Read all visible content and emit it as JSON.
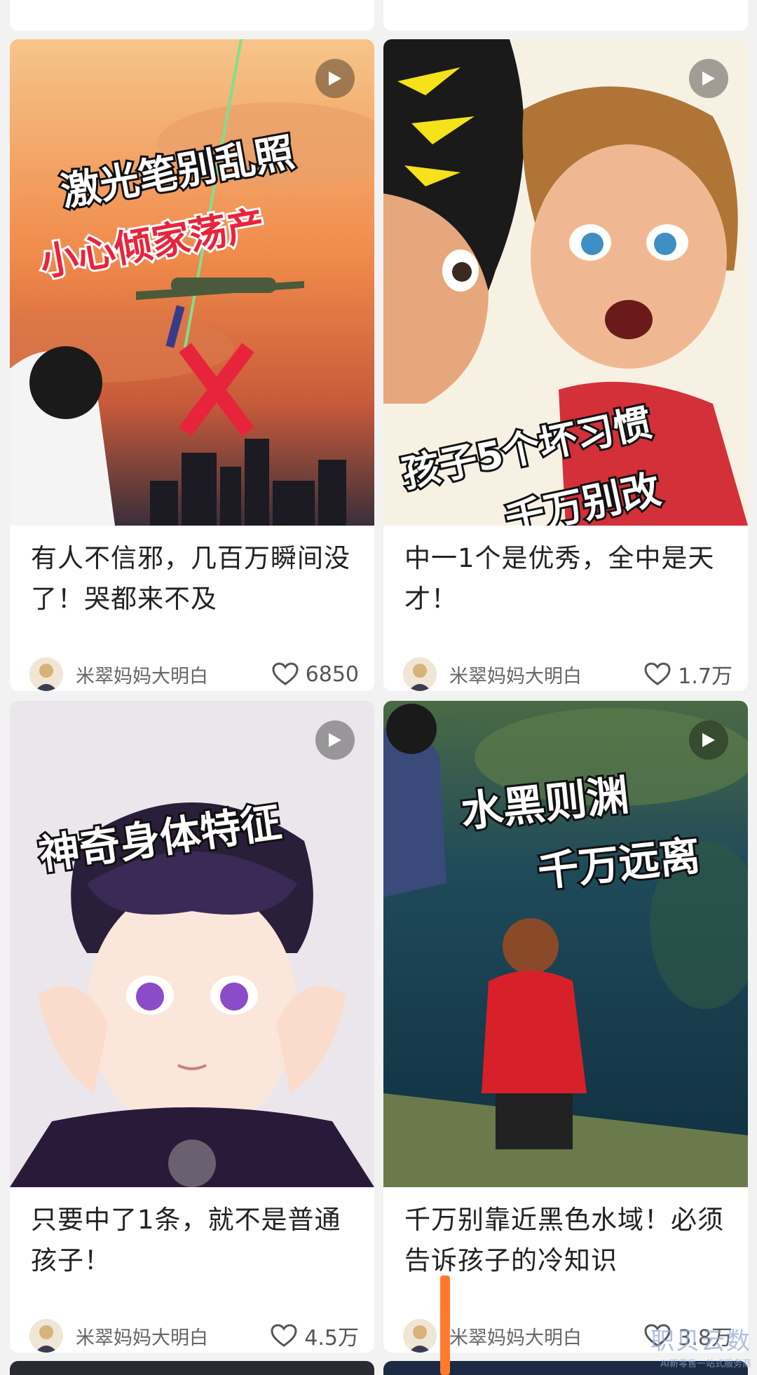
{
  "feed": {
    "cards": [
      {
        "overlay_lines": [
          "激光笔别乱照",
          "小心倾家荡产"
        ],
        "title": "有人不信邪，几百万瞬间没了！哭都来不及",
        "author": "米翠妈妈大明白",
        "likes": "6850"
      },
      {
        "overlay_lines": [
          "孩子5个坏习惯",
          "千万别改"
        ],
        "title": "中一1个是优秀，全中是天才！",
        "author": "米翠妈妈大明白",
        "likes": "1.7万"
      },
      {
        "overlay_lines": [
          "神奇身体特征"
        ],
        "title": "只要中了1条，就不是普通孩子！",
        "author": "米翠妈妈大明白",
        "likes": "4.5万"
      },
      {
        "overlay_lines": [
          "水黑则渊",
          "千万远离"
        ],
        "title": "千万别靠近黑色水域！必须告诉孩子的冷知识",
        "author": "米翠妈妈大明白",
        "likes": "3.8万"
      }
    ]
  },
  "watermark": {
    "main": "职贝云数",
    "sub": "AI新零售一站式服务商"
  },
  "colors": {
    "accent_red": "#e8243c",
    "accent_yellow": "#f5e21a",
    "scroll_marker": "#ff7a2f"
  },
  "icons": [
    "play-icon",
    "heart-icon",
    "avatar"
  ]
}
